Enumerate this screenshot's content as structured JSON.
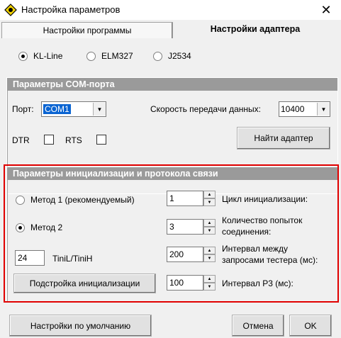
{
  "window": {
    "title": "Настройка параметров"
  },
  "tabs": [
    {
      "label": "Настройки программы"
    },
    {
      "label": "Настройки адаптера"
    }
  ],
  "adapter_types": [
    {
      "label": "KL-Line",
      "selected": true
    },
    {
      "label": "ELM327",
      "selected": false
    },
    {
      "label": "J2534",
      "selected": false
    }
  ],
  "com": {
    "header": "Параметры COM-порта",
    "port_label": "Порт:",
    "port_value": "COM1",
    "speed_label": "Скорость передачи данных:",
    "speed_value": "10400",
    "dtr_label": "DTR",
    "rts_label": "RTS",
    "find_button": "Найти адаптер"
  },
  "init": {
    "header": "Параметры инициализации и протокола связи",
    "method1_label": "Метод 1 (рекомендуемый)",
    "method2_label": "Метод 2",
    "tinil_value": "24",
    "tinil_label": "TiniL/TiniH",
    "tune_button": "Подстройка инициализации",
    "cycle_value": "1",
    "cycle_label": "Цикл инициализации:",
    "attempts_value": "3",
    "attempts_label_1": "Количество попыток",
    "attempts_label_2": "соединения:",
    "interval_value": "200",
    "interval_label_1": "Интервал между",
    "interval_label_2": "запросами тестера (мс):",
    "p3_value": "100",
    "p3_label": "Интервал Р3 (мс):"
  },
  "footer": {
    "defaults_button": "Настройки по умолчанию",
    "cancel_button": "Отмена",
    "ok_button": "OK"
  },
  "colors": {
    "highlight_border": "#e00000",
    "group_header": "#9a9a9a",
    "selection": "#0a64d2"
  }
}
